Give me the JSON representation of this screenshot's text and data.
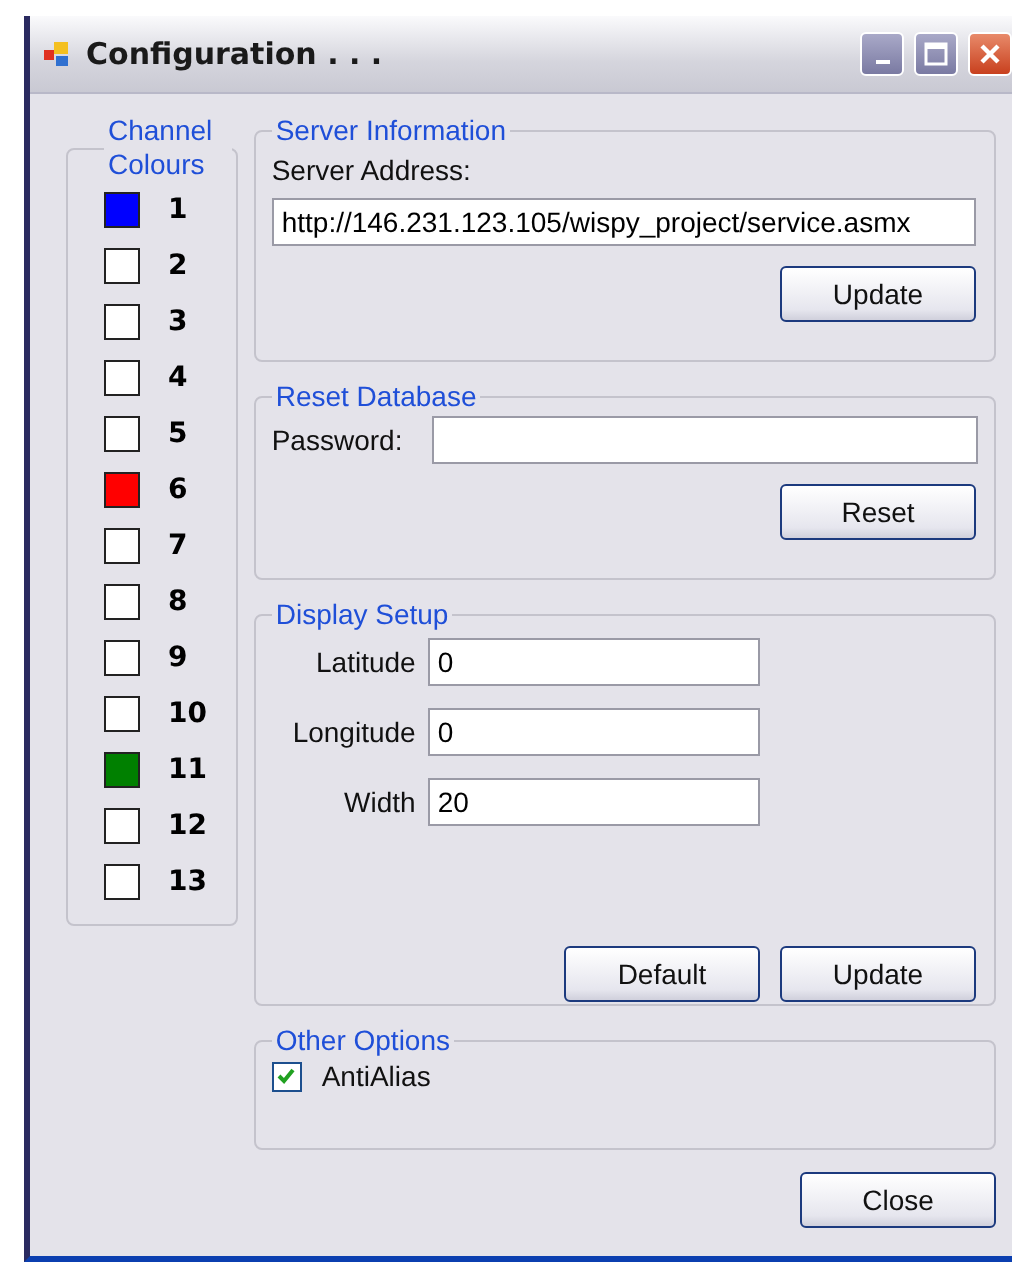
{
  "window": {
    "title": "Configuration . . ."
  },
  "channel_colours": {
    "title": "Channel Colours",
    "channels": [
      {
        "label": "1",
        "color": "#0000ff"
      },
      {
        "label": "2",
        "color": "#ffffff"
      },
      {
        "label": "3",
        "color": "#ffffff"
      },
      {
        "label": "4",
        "color": "#ffffff"
      },
      {
        "label": "5",
        "color": "#ffffff"
      },
      {
        "label": "6",
        "color": "#ff0000"
      },
      {
        "label": "7",
        "color": "#ffffff"
      },
      {
        "label": "8",
        "color": "#ffffff"
      },
      {
        "label": "9",
        "color": "#ffffff"
      },
      {
        "label": "10",
        "color": "#ffffff"
      },
      {
        "label": "11",
        "color": "#008000"
      },
      {
        "label": "12",
        "color": "#ffffff"
      },
      {
        "label": "13",
        "color": "#ffffff"
      }
    ]
  },
  "server_information": {
    "title": "Server Information",
    "label": "Server Address:",
    "value": "http://146.231.123.105/wispy_project/service.asmx",
    "button": "Update"
  },
  "reset_database": {
    "title": "Reset Database",
    "label": "Password:",
    "button": "Reset"
  },
  "display_setup": {
    "title": "Display Setup",
    "fields": [
      {
        "label": "Latitude",
        "value": "0"
      },
      {
        "label": "Longitude",
        "value": "0"
      },
      {
        "label": "Width",
        "value": "20"
      }
    ],
    "buttons": [
      "Default",
      "Update"
    ]
  },
  "other_options": {
    "title": "Other Options",
    "options": [
      {
        "label": "AntiAlias",
        "checked": true
      }
    ]
  },
  "buttons": [
    "Close"
  ]
}
